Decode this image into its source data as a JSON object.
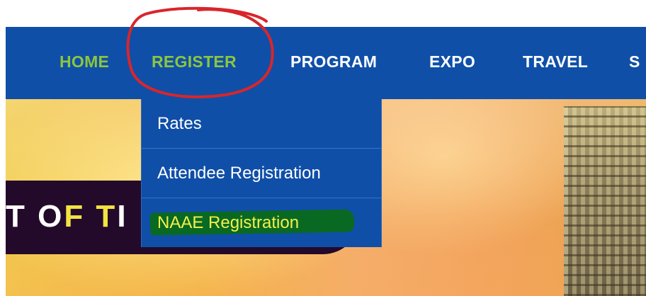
{
  "nav": {
    "items": [
      {
        "label": "HOME"
      },
      {
        "label": "REGISTER"
      },
      {
        "label": "PROGRAM"
      },
      {
        "label": "EXPO"
      },
      {
        "label": "TRAVEL"
      },
      {
        "label": "S"
      }
    ]
  },
  "dropdown": {
    "items": [
      {
        "label": "Rates"
      },
      {
        "label": "Attendee Registration"
      },
      {
        "label": "NAAE Registration"
      }
    ]
  },
  "banner": {
    "text_white": "T O",
    "text_yellow": "F T",
    "text_tail": "I"
  },
  "colors": {
    "nav_background": "#0f4fa8",
    "nav_active": "#8cc63f",
    "highlight_marker": "#0a6a1a",
    "annotation_circle": "#d8262b"
  }
}
